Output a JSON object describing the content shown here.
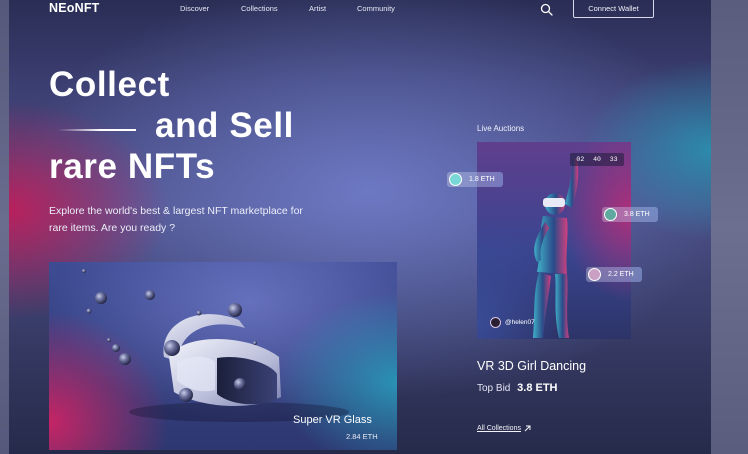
{
  "header": {
    "logo": "NEoNFT",
    "nav": [
      {
        "label": "Discover"
      },
      {
        "label": "Collections"
      },
      {
        "label": "Artist"
      },
      {
        "label": "Community"
      }
    ],
    "connect_wallet": "Connect Wallet",
    "search_icon": "search-icon"
  },
  "hero": {
    "title_line1": "Collect",
    "title_line2": "and Sell",
    "title_line3": "rare NFTs",
    "subtitle": "Explore  the world's best & largest NFT marketplace for rare items. Are you ready ?"
  },
  "featured": {
    "title": "Super VR Glass",
    "price": "2.84 ETH"
  },
  "live_auctions": {
    "label": "Live Auctions",
    "timer": [
      "02",
      "40",
      "33"
    ],
    "bids": [
      {
        "amount": "1.8 ETH",
        "color": "#7ad7d8"
      },
      {
        "amount": "3.8 ETH",
        "color": "#5fa9a0"
      },
      {
        "amount": "2.2 ETH",
        "color": "#c9a0c4"
      }
    ],
    "owner": "@helen07",
    "item_title": "VR 3D Girl Dancing",
    "top_bid_label": "Top Bid",
    "top_bid_value": "3.8 ETH",
    "all_collections": "All Collections"
  },
  "colors": {
    "background_dark": "#2a2e55",
    "accent_pink": "#be1e5a",
    "accent_teal": "#2896b4",
    "text": "#ffffff"
  }
}
